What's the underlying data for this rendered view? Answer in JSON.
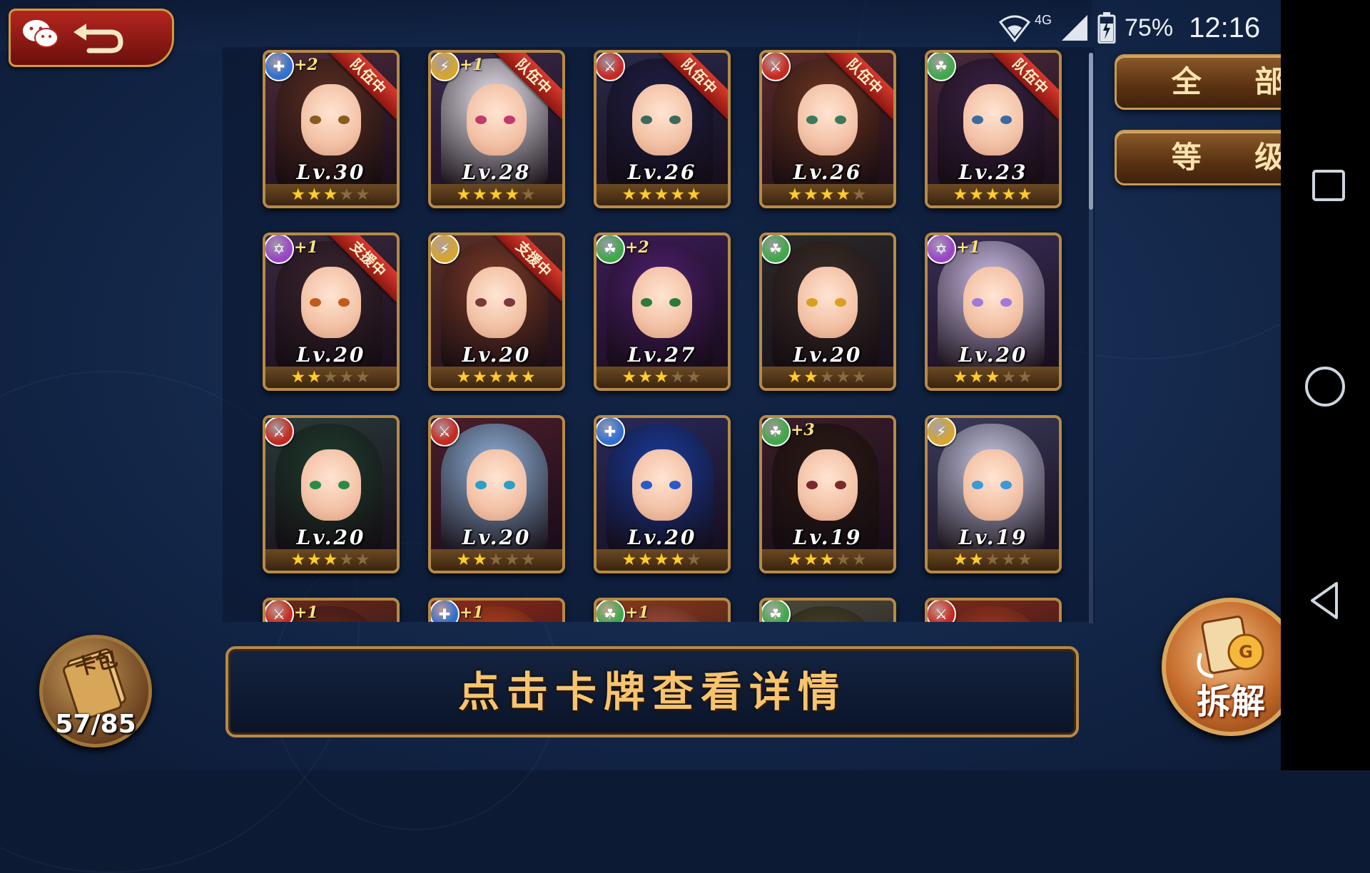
{
  "status_bar": {
    "network": "4G",
    "battery": "75%",
    "time": "12:16"
  },
  "filters": {
    "all_label": "全 部",
    "level_label": "等 级"
  },
  "hint": "点击卡牌查看详情",
  "card_pack": {
    "label": "卡包",
    "count": "57/85"
  },
  "disassemble_label": "拆解",
  "cards": [
    {
      "level": "Lv.30",
      "stars": 3,
      "element": "blue",
      "plus": "+2",
      "tag": "队伍中"
    },
    {
      "level": "Lv.28",
      "stars": 4,
      "element": "gold",
      "plus": "+1",
      "tag": "队伍中"
    },
    {
      "level": "Lv.26",
      "stars": 5,
      "element": "red",
      "plus": "",
      "tag": "队伍中"
    },
    {
      "level": "Lv.26",
      "stars": 4,
      "element": "red",
      "plus": "",
      "tag": "队伍中"
    },
    {
      "level": "Lv.23",
      "stars": 5,
      "element": "green",
      "plus": "",
      "tag": "队伍中"
    },
    {
      "level": "Lv.20",
      "stars": 2,
      "element": "purple",
      "plus": "+1",
      "tag": "支援中"
    },
    {
      "level": "Lv.20",
      "stars": 5,
      "element": "gold",
      "plus": "",
      "tag": "支援中"
    },
    {
      "level": "Lv.27",
      "stars": 3,
      "element": "green",
      "plus": "+2",
      "tag": ""
    },
    {
      "level": "Lv.20",
      "stars": 2,
      "element": "green",
      "plus": "",
      "tag": ""
    },
    {
      "level": "Lv.20",
      "stars": 3,
      "element": "purple",
      "plus": "+1",
      "tag": ""
    },
    {
      "level": "Lv.20",
      "stars": 3,
      "element": "red",
      "plus": "",
      "tag": ""
    },
    {
      "level": "Lv.20",
      "stars": 2,
      "element": "red",
      "plus": "",
      "tag": ""
    },
    {
      "level": "Lv.20",
      "stars": 4,
      "element": "blue",
      "plus": "",
      "tag": ""
    },
    {
      "level": "Lv.19",
      "stars": 3,
      "element": "green",
      "plus": "+3",
      "tag": ""
    },
    {
      "level": "Lv.19",
      "stars": 2,
      "element": "gold",
      "plus": "",
      "tag": ""
    },
    {
      "level": "",
      "stars": 0,
      "element": "red",
      "plus": "+1",
      "tag": ""
    },
    {
      "level": "",
      "stars": 0,
      "element": "blue",
      "plus": "+1",
      "tag": ""
    },
    {
      "level": "",
      "stars": 0,
      "element": "green",
      "plus": "+1",
      "tag": ""
    },
    {
      "level": "",
      "stars": 0,
      "element": "green",
      "plus": "",
      "tag": ""
    },
    {
      "level": "",
      "stars": 0,
      "element": "red",
      "plus": "",
      "tag": ""
    }
  ],
  "colors": {
    "red": "#c7281f",
    "blue": "#2f6fd0",
    "green": "#3fa84a",
    "gold": "#d8a62c",
    "purple": "#9a45c8",
    "frame": "#b68a46"
  }
}
